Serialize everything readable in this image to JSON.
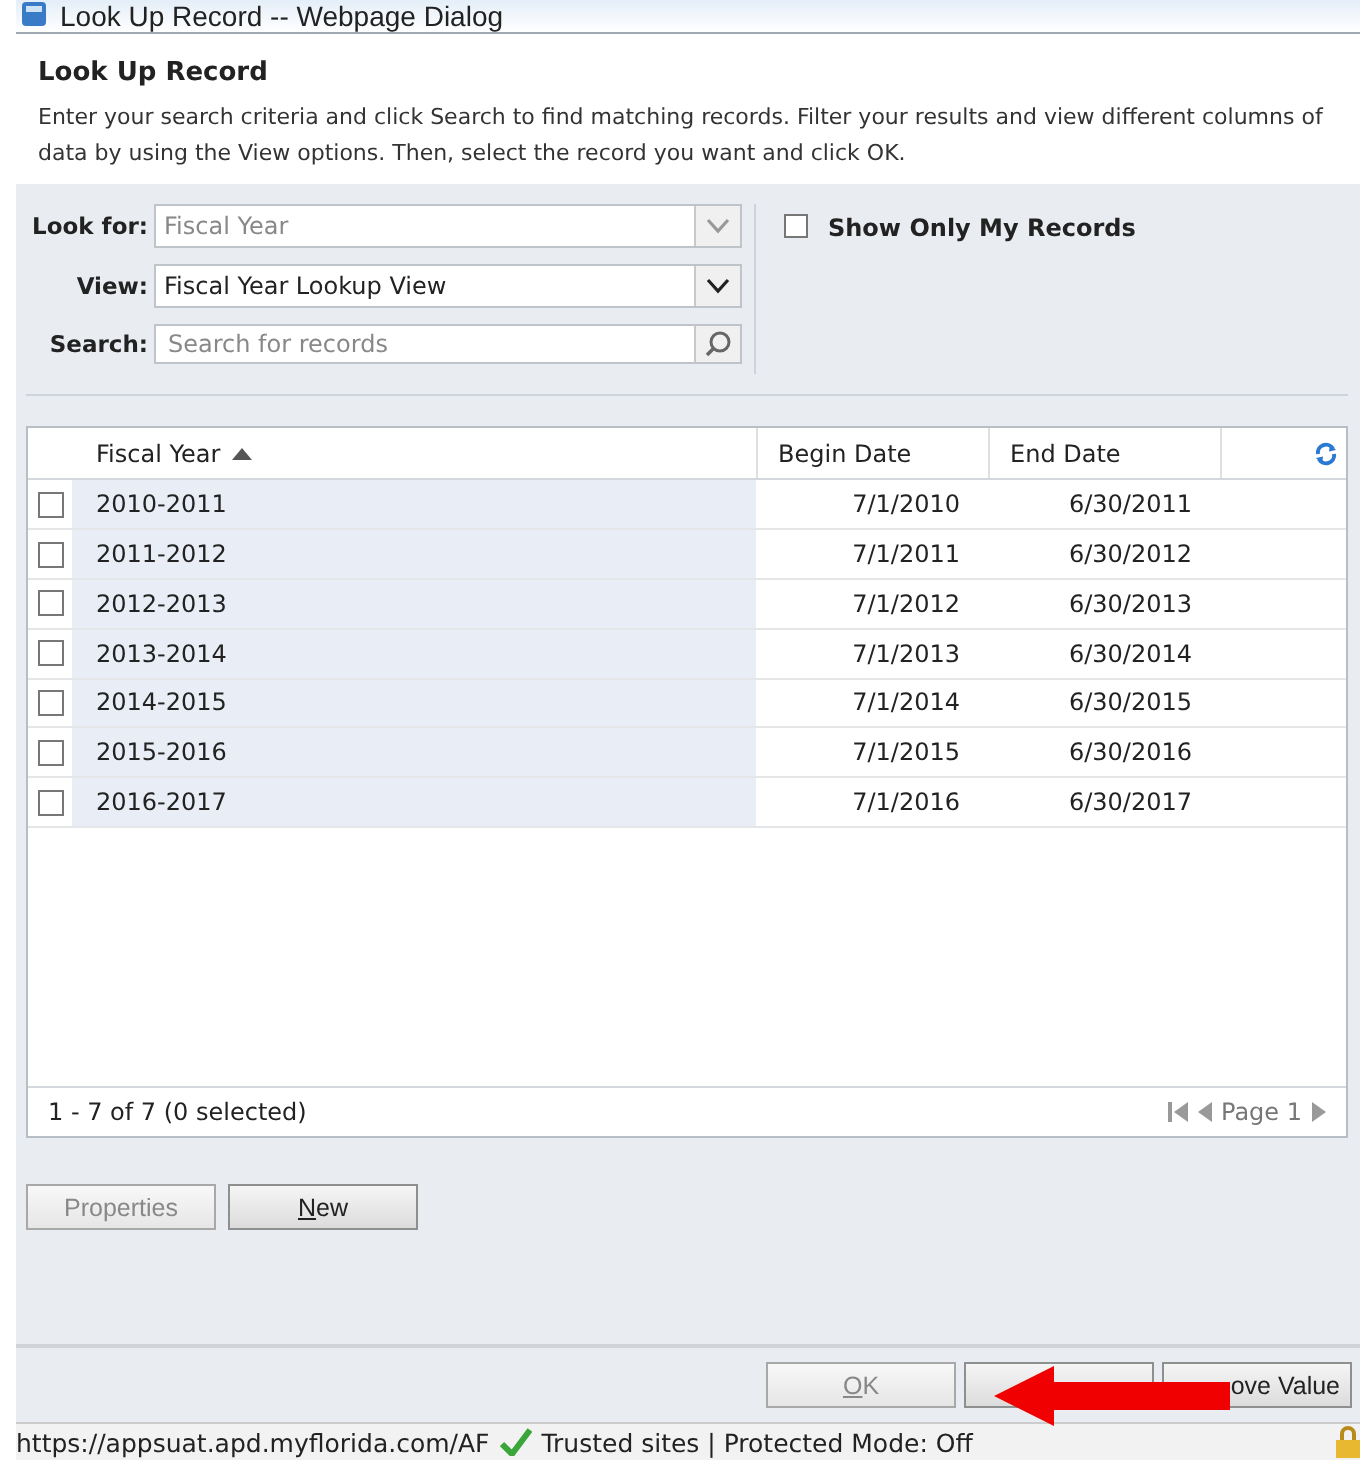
{
  "window": {
    "title": "Look Up Record -- Webpage Dialog"
  },
  "header": {
    "title": "Look Up Record",
    "description": "Enter your search criteria and click Search to find matching records. Filter your results and view different columns of data by using the View options. Then, select the record you want and click OK."
  },
  "filters": {
    "look_for": {
      "label": "Look for:",
      "value": "Fiscal Year",
      "disabled": true
    },
    "view": {
      "label": "View:",
      "value": "Fiscal Year Lookup View",
      "disabled": false
    },
    "search": {
      "label": "Search:",
      "placeholder": "Search for records"
    },
    "show_only_mine": {
      "label": "Show Only My Records",
      "checked": false
    }
  },
  "table": {
    "columns": [
      {
        "label": "Fiscal Year",
        "sorted": true
      },
      {
        "label": "Begin Date",
        "sorted": false
      },
      {
        "label": "End Date",
        "sorted": false
      }
    ],
    "rows": [
      {
        "checked": false,
        "cells": [
          "2010-2011",
          "7/1/2010",
          "6/30/2011"
        ]
      },
      {
        "checked": false,
        "cells": [
          "2011-2012",
          "7/1/2011",
          "6/30/2012"
        ]
      },
      {
        "checked": false,
        "cells": [
          "2012-2013",
          "7/1/2012",
          "6/30/2013"
        ]
      },
      {
        "checked": false,
        "cells": [
          "2013-2014",
          "7/1/2013",
          "6/30/2014"
        ]
      },
      {
        "checked": false,
        "cells": [
          "2014-2015",
          "7/1/2014",
          "6/30/2015"
        ]
      },
      {
        "checked": false,
        "cells": [
          "2015-2016",
          "7/1/2015",
          "6/30/2016"
        ]
      },
      {
        "checked": false,
        "cells": [
          "2016-2017",
          "7/1/2016",
          "6/30/2017"
        ]
      }
    ],
    "footer": "1 - 7 of 7 (0 selected)",
    "page": "Page 1"
  },
  "actions": [
    {
      "label": "Properties",
      "disabled": true,
      "mnemonic": false
    },
    {
      "label": "New",
      "disabled": false,
      "mnemonic": true
    }
  ],
  "dialog_buttons": [
    {
      "label": "OK",
      "disabled": true,
      "mnemonic": true
    },
    {
      "disabled": false
    },
    {
      "label": "ove Value",
      "disabled": false
    }
  ],
  "status_bar": {
    "url": "https://appsuat.apd.myflorida.com/AF",
    "zone": "Trusted sites | Protected Mode: Off"
  }
}
